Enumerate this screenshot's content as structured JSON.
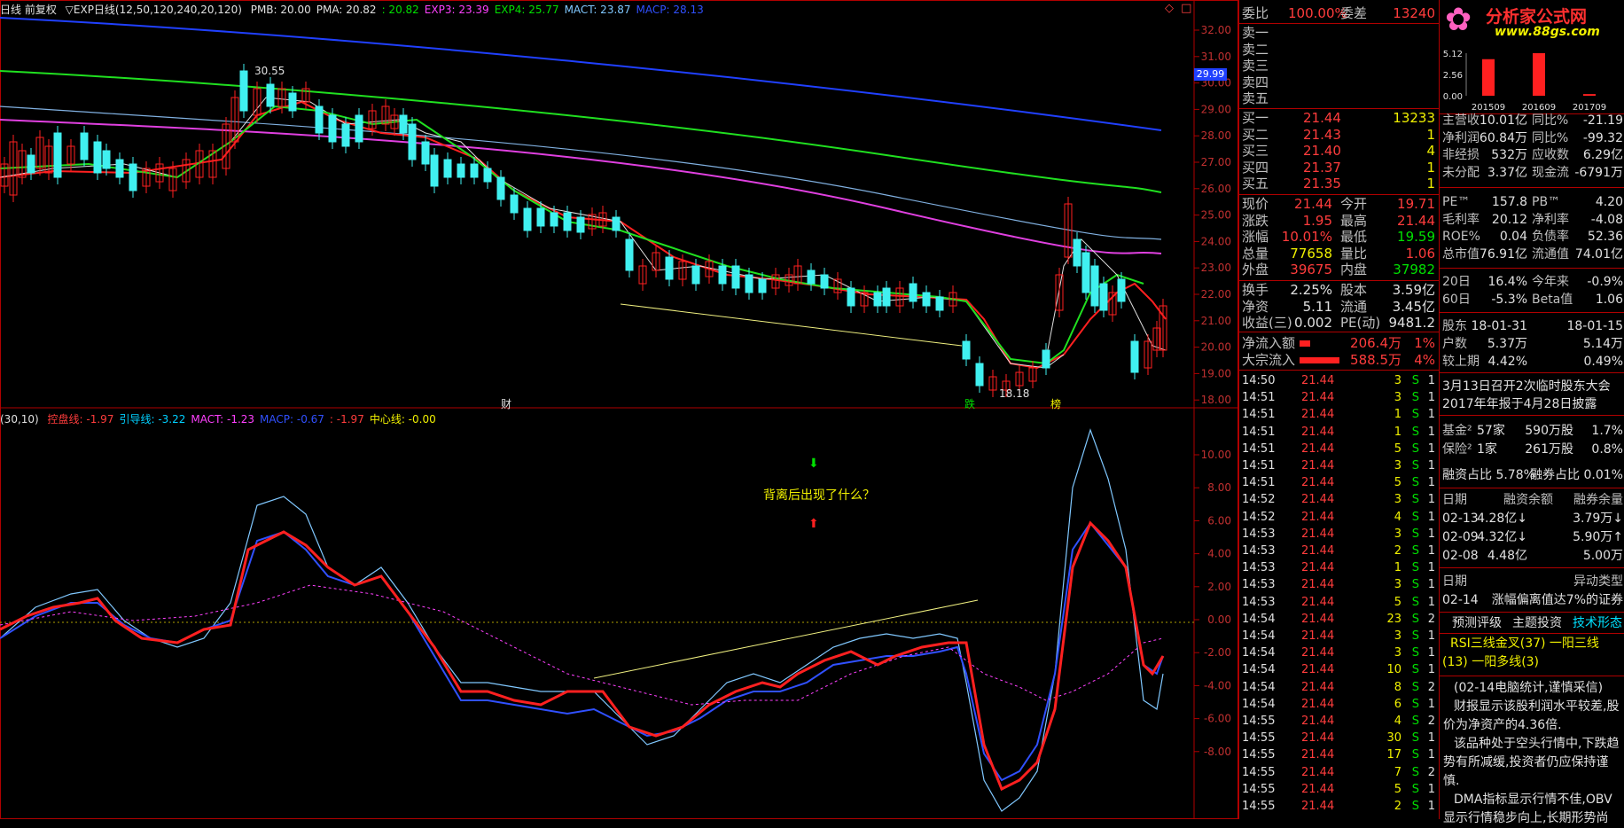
{
  "main_header": {
    "title": "日线 前复权",
    "indicator": "▽EXP日线(12,50,120,240,20,120)",
    "items": [
      {
        "label": "PMB: 20.00",
        "color": "#e0e0e0"
      },
      {
        "label": "PMA: 20.82",
        "color": "#e0e0e0"
      },
      {
        "label": ": 20.82",
        "color": "#00e000"
      },
      {
        "label": "EXP3: 23.39",
        "color": "#ff40ff"
      },
      {
        "label": "EXP4: 25.77",
        "color": "#00e000"
      },
      {
        "label": "MACT: 23.87",
        "color": "#80c8ff"
      },
      {
        "label": "MACP: 28.13",
        "color": "#3050ff"
      }
    ],
    "icons": [
      "◇",
      "□"
    ]
  },
  "price_axis": [
    "32.00",
    "31.00",
    "30.00",
    "29.00",
    "28.00",
    "27.00",
    "26.00",
    "25.00",
    "24.00",
    "23.00",
    "22.00",
    "21.00",
    "20.00",
    "19.00",
    "18.00"
  ],
  "price_marker": "29.99",
  "high_label": "30.55",
  "low_label": "18.18",
  "event_markers": [
    {
      "label": "财",
      "color": "#e0e0e0"
    },
    {
      "label": "跌",
      "color": "#00e000"
    },
    {
      "label": "榜",
      "color": "#f0f000"
    }
  ],
  "sub_header": {
    "prefix": "(30,10)",
    "items": [
      {
        "label": "控盘线: -1.97",
        "color": "#ff3c3c"
      },
      {
        "label": "引导线: -3.22",
        "color": "#00d0ff"
      },
      {
        "label": "MACT: -1.23",
        "color": "#ff40ff"
      },
      {
        "label": "MACP: -0.67",
        "color": "#3050ff"
      },
      {
        "label": ": -1.97",
        "color": "#ff3c3c"
      },
      {
        "label": "中心线: -0.00",
        "color": "#f0f000"
      }
    ]
  },
  "sub_axis": [
    "10.00",
    "8.00",
    "6.00",
    "4.00",
    "2.00",
    "0.00",
    "-2.00",
    "-4.00",
    "-6.00",
    "-8.00"
  ],
  "annotation": "背离后出现了什么？",
  "quote": {
    "weibi_label": "委比",
    "weibi": "100.00%",
    "weicha_label": "委差",
    "weicha": "13240",
    "asks": [
      {
        "label": "卖五"
      },
      {
        "label": "卖四"
      },
      {
        "label": "卖三"
      },
      {
        "label": "卖二"
      },
      {
        "label": "卖一"
      }
    ],
    "bids": [
      {
        "label": "买一",
        "price": "21.44",
        "vol": "13233"
      },
      {
        "label": "买二",
        "price": "21.43",
        "vol": "1"
      },
      {
        "label": "买三",
        "price": "21.40",
        "vol": "4"
      },
      {
        "label": "买四",
        "price": "21.37",
        "vol": "1"
      },
      {
        "label": "买五",
        "price": "21.35",
        "vol": "1"
      }
    ],
    "stats": [
      {
        "l1": "现价",
        "v1": "21.44",
        "c1": "#ff3c3c",
        "l2": "今开",
        "v2": "19.71",
        "c2": "#ff3c3c"
      },
      {
        "l1": "涨跌",
        "v1": "1.95",
        "c1": "#ff3c3c",
        "l2": "最高",
        "v2": "21.44",
        "c2": "#ff3c3c"
      },
      {
        "l1": "涨幅",
        "v1": "10.01%",
        "c1": "#ff3c3c",
        "l2": "最低",
        "v2": "19.59",
        "c2": "#00e000"
      },
      {
        "l1": "总量",
        "v1": "77658",
        "c1": "#f0f000",
        "l2": "量比",
        "v2": "1.06",
        "c2": "#ff3c3c"
      },
      {
        "l1": "外盘",
        "v1": "39675",
        "c1": "#ff3c3c",
        "l2": "内盘",
        "v2": "37982",
        "c2": "#00e000"
      }
    ],
    "stats2": [
      {
        "l1": "换手",
        "v1": "2.25%",
        "l2": "股本",
        "v2": "3.59亿"
      },
      {
        "l1": "净资",
        "v1": "5.11",
        "l2": "流通",
        "v2": "3.45亿"
      },
      {
        "l1": "收益(三)",
        "v1": "0.002",
        "l2": "PE(动)",
        "v2": "9481.2"
      }
    ],
    "flows": [
      {
        "label": "净流入额",
        "value": "206.4万",
        "pct": "1%",
        "bar": 0.12
      },
      {
        "label": "大宗流入",
        "value": "588.5万",
        "pct": "4%",
        "bar": 0.45
      }
    ]
  },
  "ticks": [
    {
      "t": "14:50",
      "p": "21.44",
      "v": "3",
      "s": "S",
      "n": "1"
    },
    {
      "t": "14:51",
      "p": "21.44",
      "v": "3",
      "s": "S",
      "n": "1"
    },
    {
      "t": "14:51",
      "p": "21.44",
      "v": "1",
      "s": "S",
      "n": "1"
    },
    {
      "t": "14:51",
      "p": "21.44",
      "v": "1",
      "s": "S",
      "n": "1"
    },
    {
      "t": "14:51",
      "p": "21.44",
      "v": "5",
      "s": "S",
      "n": "1"
    },
    {
      "t": "14:51",
      "p": "21.44",
      "v": "3",
      "s": "S",
      "n": "1"
    },
    {
      "t": "14:51",
      "p": "21.44",
      "v": "5",
      "s": "S",
      "n": "1"
    },
    {
      "t": "14:52",
      "p": "21.44",
      "v": "3",
      "s": "S",
      "n": "1"
    },
    {
      "t": "14:52",
      "p": "21.44",
      "v": "4",
      "s": "S",
      "n": "1"
    },
    {
      "t": "14:53",
      "p": "21.44",
      "v": "3",
      "s": "S",
      "n": "1"
    },
    {
      "t": "14:53",
      "p": "21.44",
      "v": "2",
      "s": "S",
      "n": "1"
    },
    {
      "t": "14:53",
      "p": "21.44",
      "v": "1",
      "s": "S",
      "n": "1"
    },
    {
      "t": "14:53",
      "p": "21.44",
      "v": "3",
      "s": "S",
      "n": "1"
    },
    {
      "t": "14:53",
      "p": "21.44",
      "v": "5",
      "s": "S",
      "n": "1"
    },
    {
      "t": "14:54",
      "p": "21.44",
      "v": "23",
      "s": "S",
      "n": "2"
    },
    {
      "t": "14:54",
      "p": "21.44",
      "v": "3",
      "s": "S",
      "n": "1"
    },
    {
      "t": "14:54",
      "p": "21.44",
      "v": "3",
      "s": "S",
      "n": "1"
    },
    {
      "t": "14:54",
      "p": "21.44",
      "v": "10",
      "s": "S",
      "n": "1"
    },
    {
      "t": "14:54",
      "p": "21.44",
      "v": "8",
      "s": "S",
      "n": "2"
    },
    {
      "t": "14:54",
      "p": "21.44",
      "v": "6",
      "s": "S",
      "n": "1"
    },
    {
      "t": "14:55",
      "p": "21.44",
      "v": "4",
      "s": "S",
      "n": "2"
    },
    {
      "t": "14:55",
      "p": "21.44",
      "v": "30",
      "s": "S",
      "n": "1"
    },
    {
      "t": "14:55",
      "p": "21.44",
      "v": "17",
      "s": "S",
      "n": "1"
    },
    {
      "t": "14:55",
      "p": "21.44",
      "v": "7",
      "s": "S",
      "n": "2"
    },
    {
      "t": "14:55",
      "p": "21.44",
      "v": "5",
      "s": "S",
      "n": "1"
    },
    {
      "t": "14:55",
      "p": "21.44",
      "v": "2",
      "s": "S",
      "n": "1"
    }
  ],
  "logo": {
    "title": "分析家公式网",
    "url": "www.88gs.com"
  },
  "mini_chart": {
    "yticks": [
      "5.12",
      "2.56",
      "0.00"
    ],
    "categories": [
      "201509",
      "201609",
      "201709"
    ],
    "values": [
      4.4,
      5.12,
      0.2
    ]
  },
  "fundamentals": [
    {
      "l1": "主营收",
      "v1": "10.01亿",
      "l2": "同比%",
      "v2": "-21.19"
    },
    {
      "l1": "净利润",
      "v1": "60.84万",
      "l2": "同比%",
      "v2": "-99.32"
    },
    {
      "l1": "非经损",
      "v1": "532万",
      "l2": "应收数",
      "v2": "6.29亿"
    },
    {
      "l1": "未分配",
      "v1": "3.37亿",
      "l2": "现金流",
      "v2": "-6791万"
    }
  ],
  "valuation": [
    {
      "l1": "PE™",
      "v1": "157.8",
      "l2": "PB™",
      "v2": "4.20"
    },
    {
      "l1": "毛利率",
      "v1": "20.12",
      "l2": "净利率",
      "v2": "-4.08"
    },
    {
      "l1": "ROE%",
      "v1": "0.04",
      "l2": "负债率",
      "v2": "52.36"
    },
    {
      "l1": "总市值",
      "v1": "76.91亿",
      "l2": "流通值",
      "v2": "74.01亿"
    }
  ],
  "returns": [
    {
      "l1": "20日",
      "v1": "16.4%",
      "l2": "今年来",
      "v2": "-0.9%"
    },
    {
      "l1": "60日",
      "v1": "-5.3%",
      "l2": "Beta值",
      "v2": "1.06"
    }
  ],
  "holders": [
    {
      "l1": "股东",
      "v1": "18-01-31",
      "v2": "18-01-15"
    },
    {
      "l1": "户数",
      "v1": "5.37万",
      "v2": "5.14万"
    },
    {
      "l1": "较上期",
      "v1": "4.42%",
      "v2": "0.49%"
    }
  ],
  "notice": [
    "3月13日召开2次临时股东大会",
    "2017年年报于4月28日披露"
  ],
  "funds": [
    {
      "l1": "基金²",
      "v1": "57家",
      "v2": "590万股",
      "v3": "1.7%"
    },
    {
      "l1": "保险²",
      "v1": "1家",
      "v2": "261万股",
      "v3": "0.8%"
    }
  ],
  "margin": {
    "rzl": "融资占比 5.78%",
    "rql": "融券占比 0.01%"
  },
  "margin_table": {
    "headers": [
      "日期",
      "融资余额",
      "融券余量"
    ],
    "rows": [
      [
        "02-13",
        "4.28亿↓",
        "3.79万↓"
      ],
      [
        "02-09",
        "4.32亿↓",
        "5.90万↑"
      ],
      [
        "02-08",
        "4.48亿",
        "5.00万"
      ]
    ]
  },
  "anomaly": {
    "headers": [
      "日期",
      "异动类型"
    ],
    "row": [
      "02-14",
      "涨幅偏离值达7%的证券"
    ]
  },
  "tabs": [
    "预测评级",
    "主题投资",
    "技术形态"
  ],
  "tech": [
    "RSI三线金叉(37) 一阳三线",
    "(13) 一阳多线(3)"
  ],
  "comments": [
    "(02-14电脑统计,谨慎采信)",
    "财报显示该股利润水平较差,股价为净资产的4.36倍.",
    "该品种处于空头行情中,下跌趋势有所减缓,投资者仍应保持谨慎.",
    "DMA指标显示行情不佳,OBV显示行情稳步向上,长期形势尚"
  ]
}
